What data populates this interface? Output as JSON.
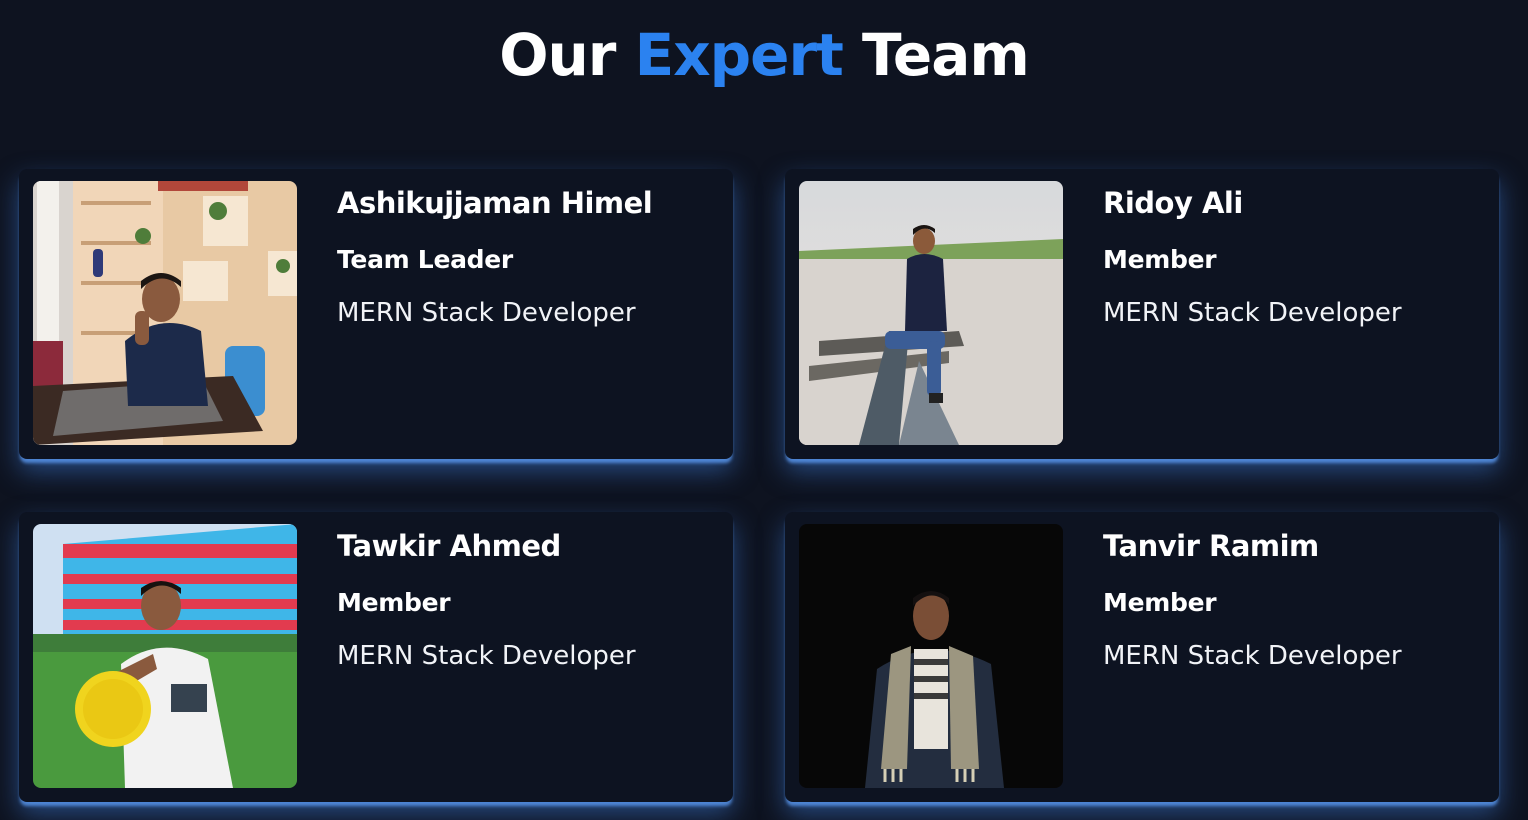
{
  "heading": {
    "part1": "Our",
    "accent": "Expert",
    "part2": "Team"
  },
  "colors": {
    "background": "#0e1320",
    "card": "#0d1321",
    "accent": "#2b82f0",
    "glow": "#5692e6"
  },
  "members": [
    {
      "name": "Ashikujjaman Himel",
      "role": "Team Leader",
      "title": "MERN Stack Developer"
    },
    {
      "name": "Ridoy Ali",
      "role": "Member",
      "title": "MERN Stack Developer"
    },
    {
      "name": "Tawkir Ahmed",
      "role": "Member",
      "title": "MERN Stack Developer"
    },
    {
      "name": "Tanvir Ramim",
      "role": "Member",
      "title": "MERN Stack Developer"
    }
  ]
}
